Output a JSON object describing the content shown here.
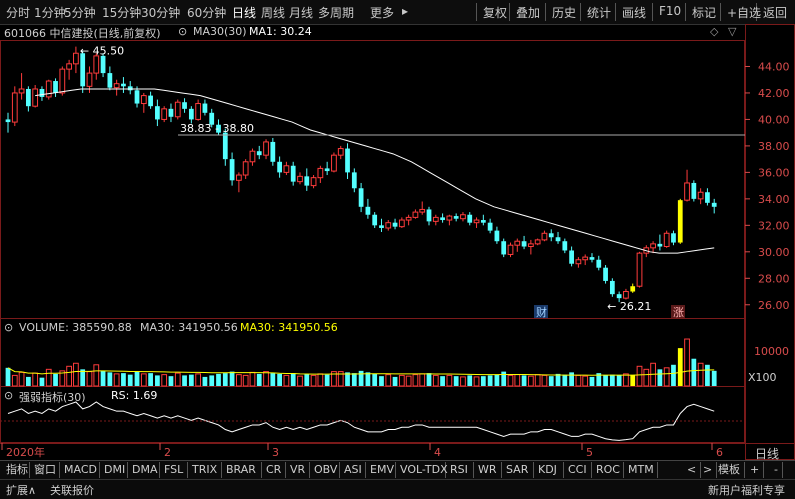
{
  "toolbar": {
    "items": [
      "分时",
      "1分钟",
      "5分钟",
      "15分钟",
      "30分钟",
      "60分钟",
      "日线",
      "周线",
      "月线",
      "多周期",
      "更多"
    ],
    "more_arrow": "▸",
    "right_items": [
      "复权",
      "叠加",
      "历史",
      "统计",
      "画线",
      "F10",
      "标记",
      "+自选",
      "返回"
    ],
    "active": "日线"
  },
  "title": {
    "stock": "601066 中信建投(日线,前复权)",
    "ma_label": "MA30(30)",
    "ma_value": "MA1: 30.24"
  },
  "colors": {
    "up": "#ff3c3c",
    "down": "#54ffff",
    "ma": "#ffffff",
    "highlight": "#ffff00",
    "axis": "#d84c4c",
    "grid": "#7a1a1a"
  },
  "annotations": {
    "high_label": "45.50",
    "low_label": "26.21",
    "range_label": "38.83 - 38.80",
    "marker_cai": "财",
    "marker_zhang": "涨"
  },
  "volume_header": {
    "label": "VOLUME: 385590.88",
    "ma": "MA30: 341950.56",
    "ma2": "MA30: 341950.56",
    "unit": "X100",
    "tick": "10000"
  },
  "rs_header": {
    "label": "强弱指标(30)",
    "value": "RS: 1.69"
  },
  "xaxis": {
    "labels": [
      "2020年",
      "2",
      "3",
      "4",
      "5",
      "6"
    ]
  },
  "right_panel": {
    "period": "日线"
  },
  "tabs": [
    "指标",
    "窗口",
    "MACD",
    "DMI",
    "DMA",
    "FSL",
    "TRIX",
    "BRAR",
    "CR",
    "VR",
    "OBV",
    "ASI",
    "EMV",
    "VOL-TDX",
    "RSI",
    "WR",
    "SAR",
    "KDJ",
    "CCI",
    "ROC",
    "MTM"
  ],
  "tabs_right": [
    "模板",
    "+",
    "-"
  ],
  "status": {
    "left1": "扩展∧",
    "left2": "关联报价",
    "right": "新用户福利专享"
  },
  "chart_data": {
    "type": "candlestick",
    "price_axis": {
      "ylim": [
        25,
        46
      ],
      "ticks": [
        26,
        28,
        30,
        32,
        34,
        36,
        38,
        40,
        42,
        44
      ]
    },
    "candles": [
      [
        40.0,
        40.5,
        39.0,
        39.8
      ],
      [
        39.8,
        42.5,
        39.5,
        42.0
      ],
      [
        42.0,
        43.5,
        41.5,
        42.3
      ],
      [
        42.3,
        42.5,
        40.6,
        41.0
      ],
      [
        41.0,
        42.6,
        40.9,
        42.3
      ],
      [
        42.3,
        42.5,
        41.4,
        41.7
      ],
      [
        41.7,
        43.0,
        41.5,
        42.9
      ],
      [
        42.9,
        43.1,
        41.7,
        42.0
      ],
      [
        42.0,
        44.0,
        41.8,
        43.8
      ],
      [
        43.8,
        44.5,
        43.0,
        44.2
      ],
      [
        44.2,
        45.5,
        43.5,
        45.0
      ],
      [
        45.0,
        45.2,
        42.0,
        42.5
      ],
      [
        42.5,
        44.0,
        42.0,
        43.5
      ],
      [
        43.5,
        45.0,
        43.0,
        44.8
      ],
      [
        44.8,
        45.0,
        43.2,
        43.5
      ],
      [
        43.5,
        44.0,
        42.2,
        42.4
      ],
      [
        42.4,
        43.0,
        41.8,
        42.7
      ],
      [
        42.7,
        43.2,
        42.0,
        42.5
      ],
      [
        42.5,
        42.9,
        41.9,
        42.2
      ],
      [
        42.2,
        42.5,
        40.9,
        41.2
      ],
      [
        41.2,
        42.0,
        40.5,
        41.8
      ],
      [
        41.8,
        42.1,
        40.8,
        41.0
      ],
      [
        41.0,
        41.5,
        39.5,
        40.0
      ],
      [
        40.0,
        41.0,
        39.8,
        40.8
      ],
      [
        40.8,
        41.2,
        39.8,
        40.2
      ],
      [
        40.2,
        41.5,
        40.0,
        41.3
      ],
      [
        41.3,
        41.6,
        40.5,
        40.8
      ],
      [
        40.8,
        41.0,
        39.7,
        40.0
      ],
      [
        40.0,
        41.5,
        39.9,
        41.2
      ],
      [
        41.2,
        41.5,
        40.3,
        40.5
      ],
      [
        40.5,
        40.8,
        39.4,
        39.6
      ],
      [
        39.6,
        40.0,
        38.8,
        39.0
      ],
      [
        39.0,
        39.3,
        36.5,
        37.0
      ],
      [
        37.0,
        37.5,
        35.0,
        35.4
      ],
      [
        35.4,
        36.0,
        34.5,
        35.8
      ],
      [
        35.8,
        37.0,
        35.5,
        36.8
      ],
      [
        36.8,
        37.8,
        36.5,
        37.6
      ],
      [
        37.6,
        38.0,
        37.0,
        37.3
      ],
      [
        37.3,
        38.5,
        37.0,
        38.3
      ],
      [
        38.3,
        38.6,
        36.5,
        36.8
      ],
      [
        36.8,
        37.2,
        35.6,
        36.0
      ],
      [
        36.0,
        36.8,
        35.8,
        36.5
      ],
      [
        36.5,
        36.8,
        35.0,
        35.3
      ],
      [
        35.3,
        36.0,
        35.1,
        35.7
      ],
      [
        35.7,
        36.3,
        34.6,
        35.0
      ],
      [
        35.0,
        35.8,
        34.8,
        35.6
      ],
      [
        35.6,
        36.5,
        35.2,
        36.3
      ],
      [
        36.3,
        36.8,
        35.8,
        36.1
      ],
      [
        36.1,
        37.5,
        36.0,
        37.3
      ],
      [
        37.3,
        38.0,
        37.0,
        37.8
      ],
      [
        37.8,
        38.2,
        35.5,
        36.0
      ],
      [
        36.0,
        36.3,
        34.5,
        34.8
      ],
      [
        34.8,
        35.2,
        33.0,
        33.4
      ],
      [
        33.4,
        34.0,
        32.5,
        32.8
      ],
      [
        32.8,
        33.0,
        31.8,
        32.0
      ],
      [
        32.0,
        32.5,
        31.5,
        31.8
      ],
      [
        31.8,
        32.4,
        31.6,
        32.2
      ],
      [
        32.2,
        32.5,
        31.7,
        31.9
      ],
      [
        31.9,
        32.6,
        31.8,
        32.4
      ],
      [
        32.4,
        32.8,
        32.0,
        32.6
      ],
      [
        32.6,
        33.2,
        32.5,
        33.0
      ],
      [
        33.0,
        33.8,
        32.8,
        33.2
      ],
      [
        33.2,
        33.4,
        32.0,
        32.3
      ],
      [
        32.3,
        32.8,
        32.0,
        32.6
      ],
      [
        32.6,
        32.9,
        32.2,
        32.4
      ],
      [
        32.4,
        32.8,
        32.0,
        32.7
      ],
      [
        32.7,
        32.9,
        32.3,
        32.5
      ],
      [
        32.5,
        33.0,
        32.3,
        32.8
      ],
      [
        32.8,
        33.0,
        32.0,
        32.2
      ],
      [
        32.2,
        32.6,
        31.8,
        32.4
      ],
      [
        32.4,
        32.8,
        32.0,
        32.2
      ],
      [
        32.2,
        32.5,
        31.4,
        31.6
      ],
      [
        31.6,
        31.9,
        30.6,
        30.8
      ],
      [
        30.8,
        31.0,
        29.6,
        29.8
      ],
      [
        29.8,
        30.7,
        29.6,
        30.5
      ],
      [
        30.5,
        31.0,
        30.0,
        30.8
      ],
      [
        30.8,
        31.2,
        30.2,
        30.4
      ],
      [
        30.4,
        30.9,
        29.8,
        30.6
      ],
      [
        30.6,
        31.0,
        30.5,
        30.9
      ],
      [
        30.9,
        31.6,
        30.8,
        31.4
      ],
      [
        31.4,
        31.7,
        30.8,
        31.1
      ],
      [
        31.1,
        31.5,
        30.6,
        30.8
      ],
      [
        30.8,
        31.0,
        29.9,
        30.1
      ],
      [
        30.1,
        30.4,
        28.9,
        29.1
      ],
      [
        29.1,
        29.6,
        28.8,
        29.4
      ],
      [
        29.4,
        29.8,
        29.0,
        29.6
      ],
      [
        29.6,
        29.9,
        29.2,
        29.4
      ],
      [
        29.4,
        29.7,
        28.6,
        28.8
      ],
      [
        28.8,
        29.0,
        27.6,
        27.8
      ],
      [
        27.8,
        28.0,
        26.6,
        26.8
      ],
      [
        26.8,
        27.0,
        26.2,
        26.5
      ],
      [
        26.5,
        27.2,
        26.4,
        27.0
      ],
      [
        27.0,
        27.6,
        26.9,
        27.4
      ],
      [
        27.4,
        30.0,
        27.3,
        29.9
      ],
      [
        29.9,
        30.5,
        29.6,
        30.3
      ],
      [
        30.3,
        30.8,
        29.9,
        30.6
      ],
      [
        30.6,
        31.3,
        30.1,
        30.4
      ],
      [
        30.4,
        31.6,
        30.3,
        31.4
      ],
      [
        31.4,
        31.6,
        30.5,
        30.7
      ],
      [
        30.7,
        34.0,
        30.6,
        33.9
      ],
      [
        33.9,
        36.2,
        33.8,
        35.2
      ],
      [
        35.2,
        35.4,
        33.8,
        34.0
      ],
      [
        34.0,
        34.8,
        33.6,
        34.5
      ],
      [
        34.5,
        34.8,
        33.5,
        33.7
      ],
      [
        33.7,
        34.0,
        32.9,
        33.4
      ]
    ],
    "ma30": [
      41.8,
      41.9,
      42.0,
      42.1,
      42.2,
      42.3,
      42.3,
      42.3,
      42.3,
      42.3,
      42.3,
      42.3,
      42.3,
      42.3,
      42.2,
      42.1,
      42.0,
      41.9,
      41.8,
      41.6,
      41.4,
      41.2,
      41.0,
      40.8,
      40.6,
      40.4,
      40.2,
      40.0,
      39.8,
      39.5,
      39.2,
      39.0,
      38.8,
      38.6,
      38.4,
      38.2,
      38.0,
      37.8,
      37.6,
      37.4,
      37.1,
      36.8,
      36.4,
      36.0,
      35.6,
      35.2,
      34.8,
      34.4,
      34.0,
      33.7,
      33.4,
      33.2,
      33.0,
      32.8,
      32.6,
      32.4,
      32.2,
      32.0,
      31.8,
      31.6,
      31.4,
      31.2,
      31.0,
      30.8,
      30.6,
      30.4,
      30.2,
      30.0,
      29.9,
      29.9,
      29.9,
      30.0,
      30.1,
      30.2,
      30.3
    ],
    "ma30_start_index": 4,
    "volume": [
      120,
      70,
      90,
      60,
      85,
      55,
      110,
      80,
      100,
      130,
      150,
      110,
      95,
      140,
      100,
      90,
      80,
      85,
      75,
      95,
      80,
      85,
      70,
      75,
      65,
      85,
      70,
      75,
      80,
      60,
      70,
      80,
      85,
      95,
      75,
      70,
      90,
      80,
      95,
      85,
      80,
      70,
      85,
      65,
      80,
      70,
      80,
      75,
      95,
      95,
      90,
      85,
      100,
      90,
      80,
      65,
      75,
      60,
      70,
      65,
      75,
      80,
      85,
      70,
      65,
      70,
      65,
      60,
      70,
      60,
      65,
      70,
      75,
      95,
      70,
      75,
      70,
      65,
      75,
      70,
      65,
      80,
      75,
      90,
      70,
      65,
      60,
      85,
      70,
      75,
      70,
      80,
      70,
      130,
      110,
      150,
      110,
      120,
      140,
      250,
      310,
      180,
      150,
      140,
      100
    ],
    "rs": [
      12,
      13,
      14,
      12,
      13,
      12,
      14,
      13,
      15,
      16,
      17,
      14,
      15,
      17,
      15,
      14,
      13,
      13,
      12,
      11,
      12,
      11,
      10,
      11,
      10,
      11,
      10,
      9,
      10,
      9,
      8,
      7,
      5,
      4,
      5,
      6,
      7,
      7,
      8,
      6,
      5,
      6,
      5,
      6,
      5,
      6,
      7,
      7,
      8,
      9,
      8,
      6,
      5,
      4,
      4,
      4,
      5,
      5,
      6,
      6,
      7,
      7,
      6,
      6,
      6,
      6,
      6,
      6,
      6,
      6,
      5,
      4,
      3,
      2,
      3,
      3,
      3,
      4,
      4,
      5,
      5,
      4,
      3,
      2,
      2,
      3,
      3,
      2,
      1,
      0.5,
      0.3,
      0.6,
      1,
      4,
      5,
      6,
      6,
      7,
      7,
      12,
      15,
      16,
      15,
      14,
      13
    ]
  }
}
